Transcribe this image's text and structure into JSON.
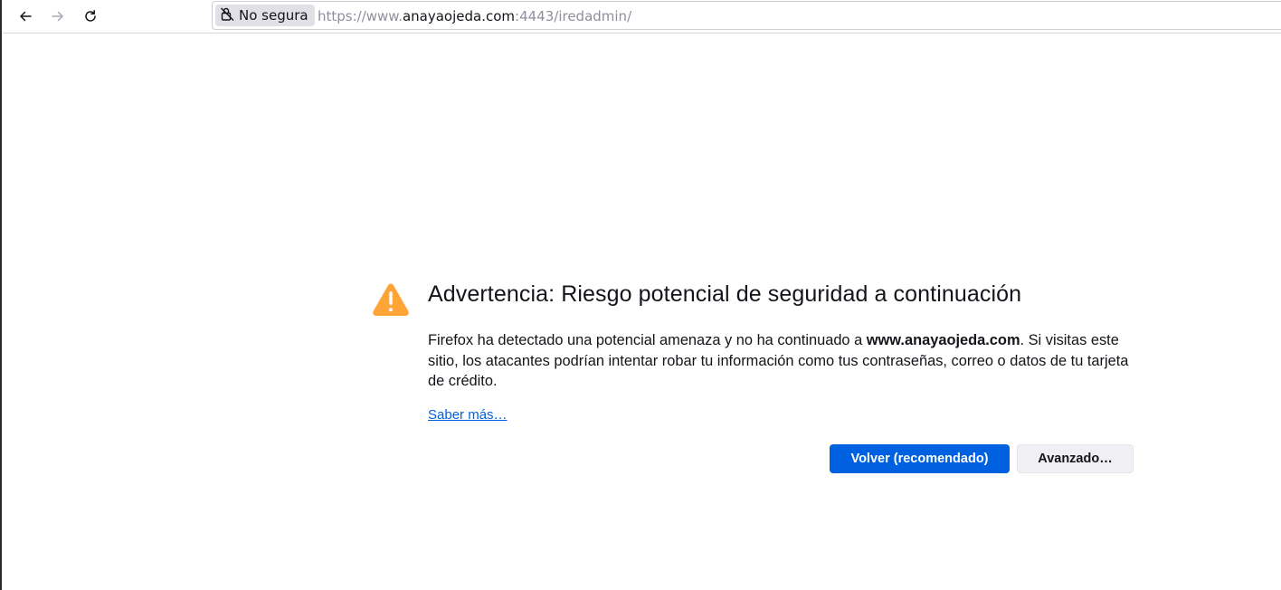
{
  "browser": {
    "nav": {
      "back_icon": "arrow-left-icon",
      "forward_icon": "arrow-right-icon",
      "reload_icon": "reload-icon"
    },
    "urlbar": {
      "security_label": "No segura",
      "security_icon": "lock-warning-icon",
      "url_prefix": "https://www.",
      "url_host": "anayaojeda.com",
      "url_suffix": ":4443/iredadmin/"
    }
  },
  "error_page": {
    "icon": "warning-triangle-icon",
    "icon_color": "#ffa436",
    "title": "Advertencia: Riesgo potencial de seguridad a continuación",
    "description_before": "Firefox ha detectado una potencial amenaza y no ha continuado a ",
    "description_host": "www.anayaojeda.com",
    "description_after": ". Si visitas este sitio, los atacantes podrían intentar robar tu información como tus contraseñas, correo o datos de tu tarjeta de crédito.",
    "learn_more": "Saber más…",
    "primary_button": "Volver (recomendado)",
    "secondary_button": "Avanzado…",
    "accent_color": "#0061e0"
  }
}
